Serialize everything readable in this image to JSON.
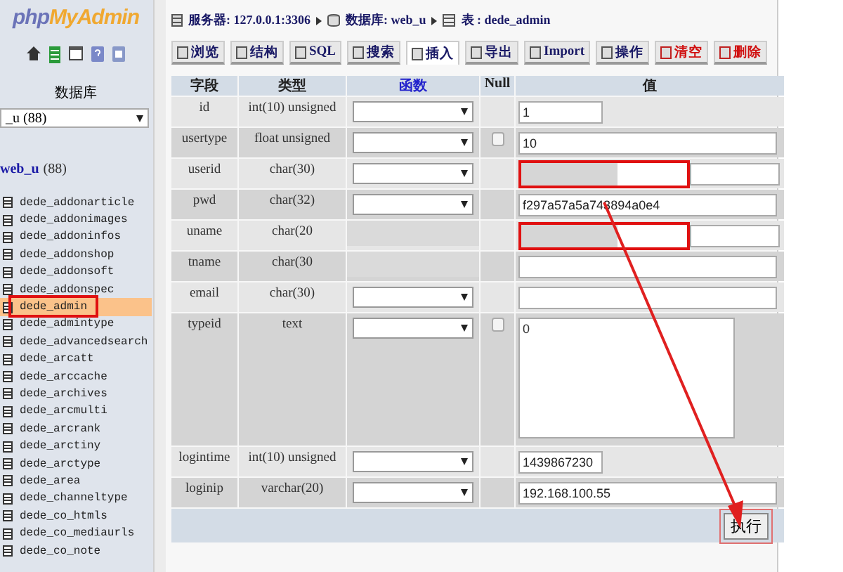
{
  "sidebar": {
    "logo_prefix": "php",
    "logo_suffix": "MyAdmin",
    "db_label": "数据库",
    "db_select": "_u (88)",
    "db_link": "web_u",
    "db_count": "(88)",
    "tables": [
      {
        "name": "dede_addonarticle",
        "selected": false
      },
      {
        "name": "dede_addonimages",
        "selected": false
      },
      {
        "name": "dede_addoninfos",
        "selected": false
      },
      {
        "name": "dede_addonshop",
        "selected": false
      },
      {
        "name": "dede_addonsoft",
        "selected": false
      },
      {
        "name": "dede_addonspec",
        "selected": false
      },
      {
        "name": "dede_admin",
        "selected": true
      },
      {
        "name": "dede_admintype",
        "selected": false
      },
      {
        "name": "dede_advancedsearch",
        "selected": false
      },
      {
        "name": "dede_arcatt",
        "selected": false
      },
      {
        "name": "dede_arccache",
        "selected": false
      },
      {
        "name": "dede_archives",
        "selected": false
      },
      {
        "name": "dede_arcmulti",
        "selected": false
      },
      {
        "name": "dede_arcrank",
        "selected": false
      },
      {
        "name": "dede_arctiny",
        "selected": false
      },
      {
        "name": "dede_arctype",
        "selected": false
      },
      {
        "name": "dede_area",
        "selected": false
      },
      {
        "name": "dede_channeltype",
        "selected": false
      },
      {
        "name": "dede_co_htmls",
        "selected": false
      },
      {
        "name": "dede_co_mediaurls",
        "selected": false
      },
      {
        "name": "dede_co_note",
        "selected": false
      }
    ]
  },
  "breadcrumb": [
    {
      "label": "服务器: 127.0.0.1:3306",
      "kind": "server"
    },
    {
      "label": "数据库: web_u",
      "kind": "database"
    },
    {
      "label": "表 : dede_admin",
      "kind": "table"
    }
  ],
  "tabs": [
    {
      "label": "浏览",
      "selected": false,
      "danger": false
    },
    {
      "label": "结构",
      "selected": false,
      "danger": false
    },
    {
      "label": "SQL",
      "selected": false,
      "danger": false
    },
    {
      "label": "搜索",
      "selected": false,
      "danger": false
    },
    {
      "label": "插入",
      "selected": true,
      "danger": false
    },
    {
      "label": "导出",
      "selected": false,
      "danger": false
    },
    {
      "label": "Import",
      "selected": false,
      "danger": false
    },
    {
      "label": "操作",
      "selected": false,
      "danger": false
    },
    {
      "label": "清空",
      "selected": false,
      "danger": true
    },
    {
      "label": "删除",
      "selected": false,
      "danger": true
    }
  ],
  "columns": [
    {
      "label": "字段",
      "link": false
    },
    {
      "label": "类型",
      "link": false
    },
    {
      "label": "函数",
      "link": true
    },
    {
      "label": "Null",
      "link": false
    },
    {
      "label": "值",
      "link": false
    }
  ],
  "rows": [
    {
      "field": "id",
      "type": "int(10) unsigned",
      "covered": false,
      "has_null": false,
      "kind": "short",
      "value": "1",
      "highlighted": false
    },
    {
      "field": "usertype",
      "type": "float unsigned",
      "covered": false,
      "has_null": true,
      "null_checked": false,
      "kind": "long",
      "value": "10",
      "highlighted": false
    },
    {
      "field": "userid",
      "type": "char(30)",
      "covered": false,
      "has_null": false,
      "kind": "long",
      "value": "",
      "highlighted": true
    },
    {
      "field": "pwd",
      "type": "char(32)",
      "covered": false,
      "has_null": false,
      "kind": "long",
      "value": "f297a57a5a743894a0e4",
      "highlighted": false
    },
    {
      "field": "uname",
      "type": "char(20",
      "covered": true,
      "has_null": false,
      "kind": "long",
      "value": "",
      "highlighted": true
    },
    {
      "field": "tname",
      "type": "char(30",
      "covered": true,
      "has_null": false,
      "kind": "long",
      "value": "",
      "highlighted": false
    },
    {
      "field": "email",
      "type": "char(30)",
      "covered": false,
      "has_null": false,
      "kind": "long",
      "value": "",
      "highlighted": false
    },
    {
      "field": "typeid",
      "type": "text",
      "covered": false,
      "has_null": true,
      "null_checked": false,
      "kind": "textarea",
      "value": "0"
    },
    {
      "field": "logintime",
      "type": "int(10) unsigned",
      "covered": false,
      "has_null": false,
      "kind": "short",
      "value": "1439867230",
      "highlighted": false
    },
    {
      "field": "loginip",
      "type": "varchar(20)",
      "covered": false,
      "has_null": false,
      "kind": "long",
      "value": "192.168.100.55",
      "highlighted": false
    }
  ],
  "submit": {
    "label": "执行",
    "highlighted": true
  }
}
